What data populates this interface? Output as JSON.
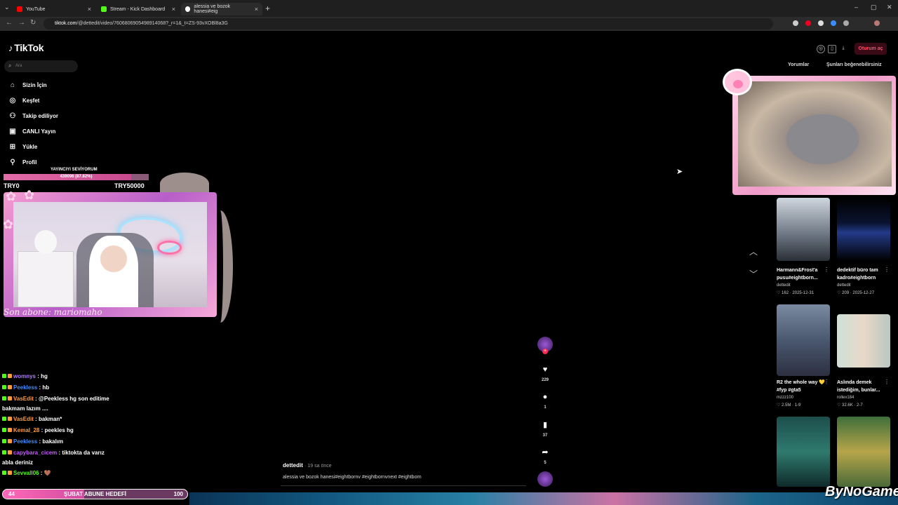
{
  "browser": {
    "tabs": [
      {
        "label": "YouTube",
        "color": "#ff0000"
      },
      {
        "label": "Stream - Kick Dashboard",
        "color": "#53fc18"
      },
      {
        "label": "alessia ve bozok hanesi#eig",
        "color": "#ffffff"
      }
    ],
    "url_host": "tiktok.com",
    "url_path": "/@dettedit/video/7606806905498914068?_r=1&_t=ZS-93vXOBl8a3G"
  },
  "tiktok": {
    "logo": "TikTok",
    "search_placeholder": "Ara",
    "nav": [
      "Sizin İçin",
      "Keşfet",
      "Takip ediliyor",
      "CANLI Yayın",
      "Yükle",
      "Profil"
    ],
    "login": "Oturum aç",
    "right_tabs": [
      "Yorumlar",
      "Şunları beğenebilirsiniz"
    ],
    "video": {
      "author": "dettedit",
      "time": "· 19 sa önce",
      "description": "alessia ve bozok hanesi#eightbornv #eightbornvnext #eightborn"
    },
    "actions": {
      "likes": "229",
      "comments": "1",
      "saves": "37",
      "shares": "5"
    },
    "recommendations": [
      {
        "title": "Harmann&Frost'a pusu#eightborn...",
        "user": "dettedit",
        "stats": "♡ 162 · 2025-12-31"
      },
      {
        "title": "dedektif büro tam kadro#eightborn",
        "user": "dettedit",
        "stats": "♡ 209 · 2025-12-27"
      },
      {
        "title": "R2 the whole way 💛 #fyp #gta5",
        "user": "mzzz100",
        "stats": "♡ 2.5M · 1-9"
      },
      {
        "title": "Aslında demek istediğim, bunlar...",
        "user": "rollex184",
        "stats": "♡ 32.6K · 2-7"
      }
    ]
  },
  "overlay": {
    "goal_title": "YAYINCIYI SEVİYORUM",
    "goal_pct_text": "439096 (87.82%)",
    "goal_fraction": 0.8782,
    "goal_min": "TRY0",
    "goal_max": "TRY50000",
    "son_abone": "Son abone: mariomaho",
    "chat": [
      {
        "user": "womnys",
        "color": "#b07cff",
        "msg": " : hg"
      },
      {
        "user": "Peekless",
        "color": "#3f8cff",
        "msg": " : hb"
      },
      {
        "user": "VasEdit",
        "color": "#ff9a3c",
        "msg": " : @Peekless hg son editime"
      },
      {
        "cont": "bakmam lazım ...."
      },
      {
        "user": "VasEdit",
        "color": "#ff9a3c",
        "msg": " : bakman*"
      },
      {
        "user": "Kemal_28",
        "color": "#ff9a3c",
        "msg": " : peekles hg"
      },
      {
        "user": "Peekless",
        "color": "#3f8cff",
        "msg": " : bakalım"
      },
      {
        "user": "capybara_cicem",
        "color": "#c45cff",
        "msg": " : tiktokta da varız"
      },
      {
        "cont": "abla deriniz"
      },
      {
        "user": "Sevvall06",
        "color": "#53fc18",
        "msg": " : 🤎"
      }
    ],
    "sub_goal": {
      "current": "44",
      "title": "ŞUBAT ABUNE HEDEFİ",
      "target": "100",
      "fraction": 0.44
    },
    "watermark": "ByNoGame"
  }
}
